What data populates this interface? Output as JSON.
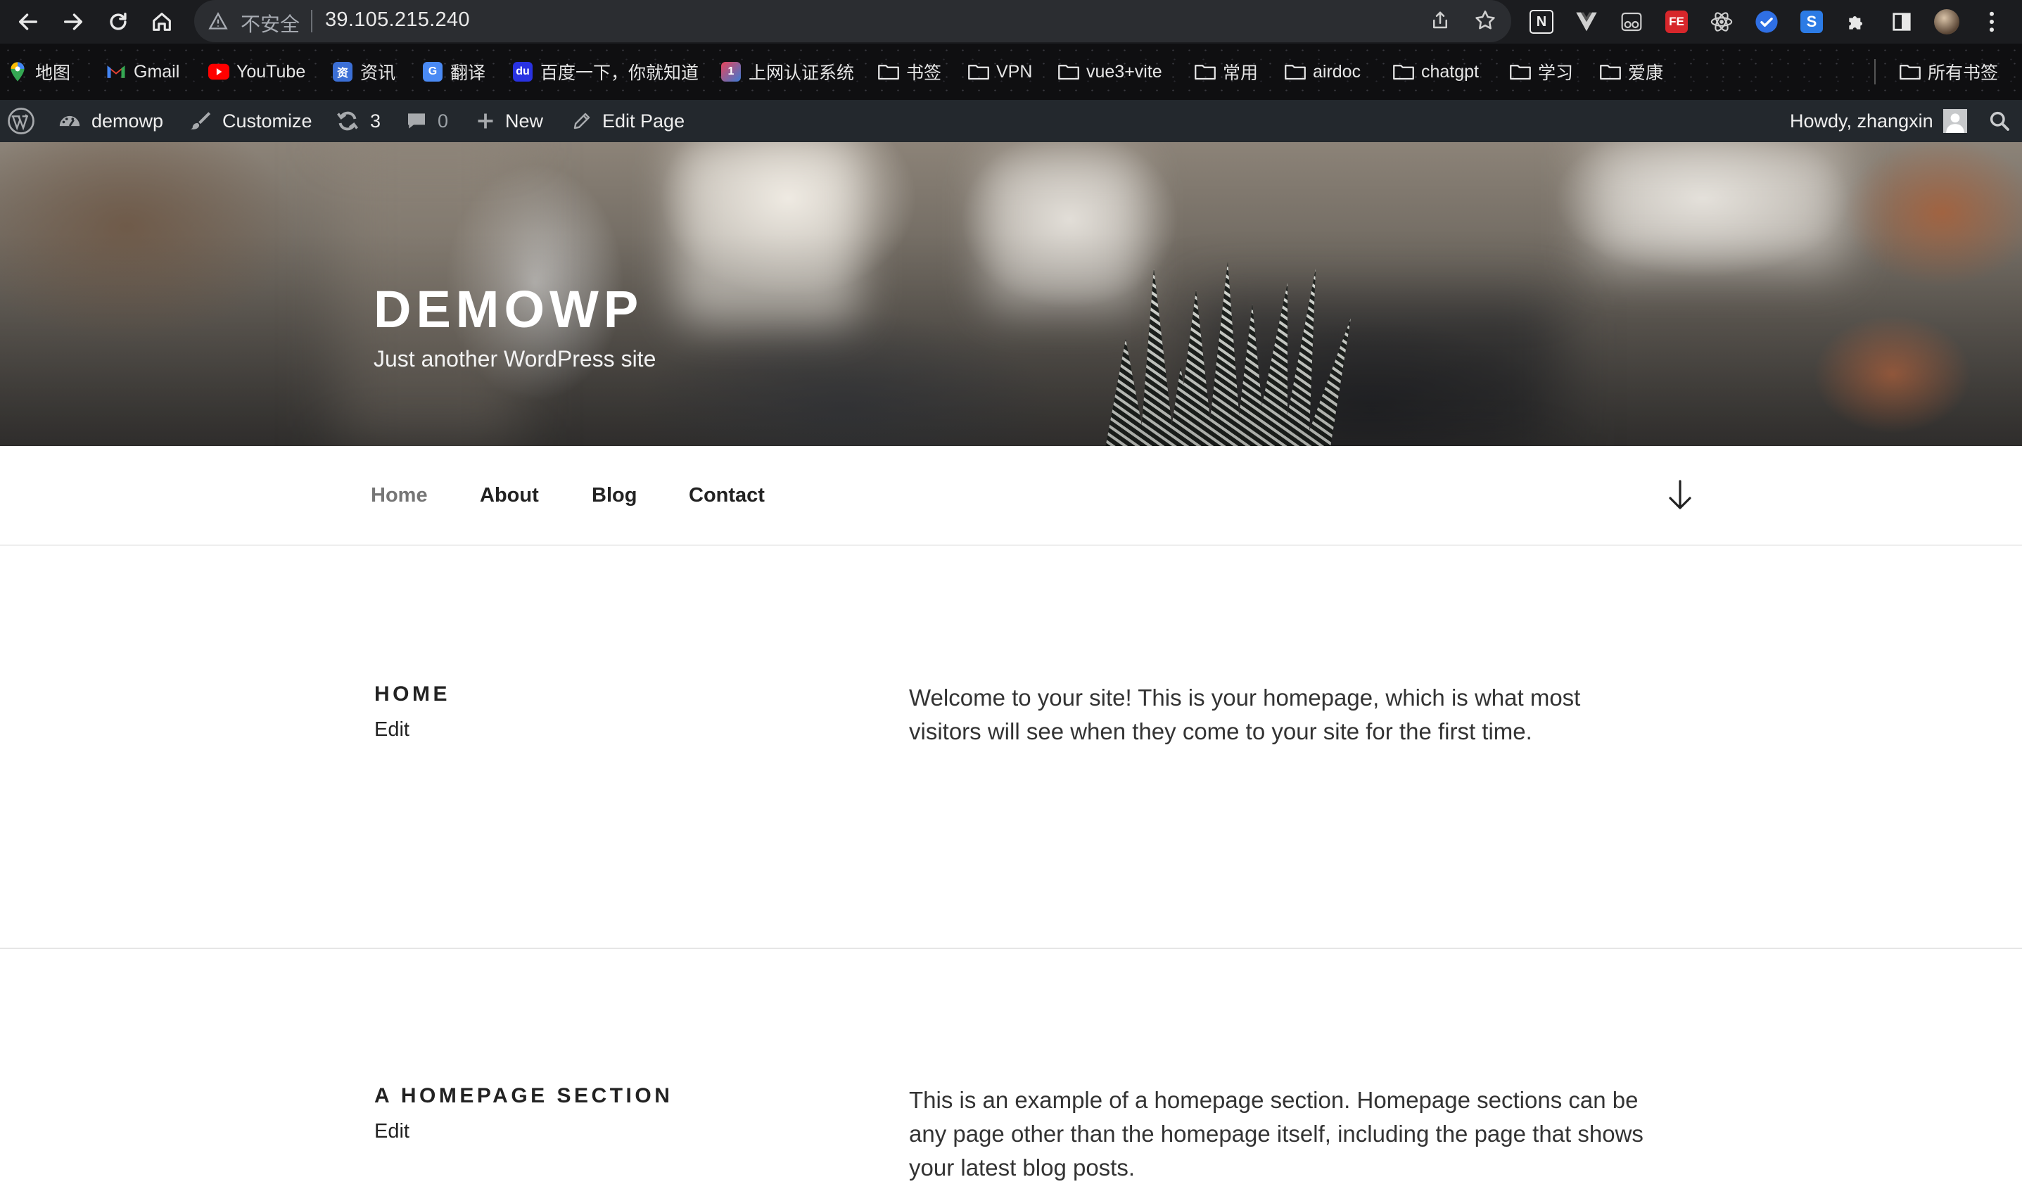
{
  "browser": {
    "insecure_label": "不安全",
    "url": "39.105.215.240",
    "extensions": [
      "notion-icon",
      "vue-devtools-icon",
      "reader-icon",
      "fe-helper-icon",
      "react-devtools-icon",
      "check-icon",
      "s-extension-icon",
      "puzzle-extensions-icon",
      "sidebar-icon",
      "profile-avatar-icon",
      "more-menu-icon"
    ]
  },
  "bookmarks": [
    {
      "label": "地图",
      "icon": "maps-icon"
    },
    {
      "label": "Gmail",
      "icon": "gmail-icon"
    },
    {
      "label": "YouTube",
      "icon": "youtube-icon"
    },
    {
      "label": "资讯",
      "icon": "news-icon"
    },
    {
      "label": "翻译",
      "icon": "translate-icon"
    },
    {
      "label": "百度一下，你就知道",
      "icon": "baidu-icon"
    },
    {
      "label": "上网认证系统",
      "icon": "auth-icon"
    },
    {
      "label": "书签",
      "icon": "folder-icon"
    },
    {
      "label": "VPN",
      "icon": "folder-icon"
    },
    {
      "label": "vue3+vite",
      "icon": "folder-icon"
    },
    {
      "label": "常用",
      "icon": "folder-icon"
    },
    {
      "label": "airdoc",
      "icon": "folder-icon"
    },
    {
      "label": "chatgpt",
      "icon": "folder-icon"
    },
    {
      "label": "学习",
      "icon": "folder-icon"
    },
    {
      "label": "爱康",
      "icon": "folder-icon"
    }
  ],
  "all_bookmarks_label": "所有书签",
  "admin_bar": {
    "site_name": "demowp",
    "customize": "Customize",
    "updates_count": "3",
    "comments_count": "0",
    "new_label": "New",
    "edit_page": "Edit Page",
    "greeting": "Howdy, zhangxin"
  },
  "site": {
    "title": "DEMOWP",
    "tagline": "Just another WordPress site"
  },
  "nav": {
    "items": [
      "Home",
      "About",
      "Blog",
      "Contact"
    ],
    "current": "Home"
  },
  "panels": [
    {
      "title": "HOME",
      "edit": "Edit",
      "body": "Welcome to your site! This is your homepage, which is what most visitors will see when they come to your site for the first time."
    },
    {
      "title": "A HOMEPAGE SECTION",
      "edit": "Edit",
      "body": "This is an example of a homepage section. Homepage sections can be any page other than the homepage itself, including the page that shows your latest blog posts."
    }
  ]
}
